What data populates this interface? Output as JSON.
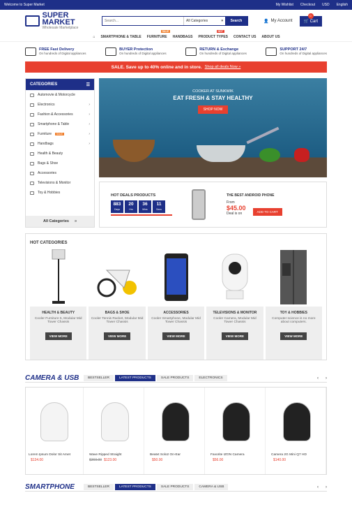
{
  "topbar": {
    "welcome": "Welcome to Super Market",
    "wishlist": "My Wishlist",
    "checkout": "Checkout",
    "currency": "USD",
    "language": "English"
  },
  "logo": {
    "name": "SUPER MARKET",
    "tagline": "Wholesale Marketplace"
  },
  "search": {
    "placeholder": "Search...",
    "category": "All Categories",
    "button": "Search"
  },
  "header": {
    "account": "My Account",
    "cart": "Cart",
    "cart_count": "0"
  },
  "nav": {
    "items": [
      "SMARTPHONE & TABLE",
      "FURNITURE",
      "HANDBAGS",
      "PRODUCT TYPES",
      "CONTACT US",
      "ABOUT US"
    ],
    "tag_sale": "SALE",
    "tag_hot": "HOT"
  },
  "features": [
    {
      "title": "FREE Fast Delivery",
      "sub": "On hundreds of Digital appliances"
    },
    {
      "title": "BUYER Protection",
      "sub": "On hundreds of Digital appliances"
    },
    {
      "title": "RETURN & Exchange",
      "sub": "On hundreds of Digital appliances"
    },
    {
      "title": "SUPPORT 24/7",
      "sub": "On hundreds of Digital appliances"
    }
  ],
  "sale": {
    "text": "SALE. Save up to 40% online and in store.",
    "link": "Shop all deals Now »"
  },
  "categories": {
    "title": "CATEGORIES",
    "items": [
      "Automovie & Motorcycle",
      "Electronics",
      "Fashion & Accessories",
      "Smartphone & Table",
      "Furniture",
      "Handbags",
      "Health & Beauty",
      "Bags & Shoe",
      "Accessories",
      "Televisions & Monitor",
      "Toy & Hobbies"
    ],
    "sale_tag": "SALE",
    "all": "All Categories"
  },
  "banner": {
    "line1": "COOKER AT SUNKWIK",
    "line2": "EAT FRESH & STAY HEALTHY",
    "button": "SHOP NOW"
  },
  "deals": {
    "title": "HOT DEALS PRODUCTS",
    "countdown": [
      {
        "v": "883",
        "l": "Days"
      },
      {
        "v": "20",
        "l": "Hrs"
      },
      {
        "v": "36",
        "l": "Mins"
      },
      {
        "v": "11",
        "l": "Secs"
      }
    ],
    "product": "THE BEST ANDROID PHONE",
    "from": "From",
    "price": "$45.00",
    "deal": "Deal is on",
    "add": "ADD TO CART"
  },
  "hot_categories": {
    "title": "HOT CATEGORIES",
    "items": [
      {
        "name": "HEALTH & BEAUTY",
        "desc": "Cooler Furniture 5, Modular Mid Tower Chassis"
      },
      {
        "name": "BAGS & SHOE",
        "desc": "Cooler Tennis Racket, Modular Mid Tower Chassis"
      },
      {
        "name": "ACCESSORIES",
        "desc": "Cooler Smartphone, Modular Mid Tower Chassis"
      },
      {
        "name": "TELEVISIONS & MONITOR",
        "desc": "Cooler Camera, Modular Mid Tower Chassis"
      },
      {
        "name": "TOY & HOBBIES",
        "desc": "Computer science is no more about computers."
      }
    ],
    "button": "VIEW MORE"
  },
  "camera": {
    "title": "CAMERA & USB",
    "tabs": [
      "BESTSELLER",
      "LATEST PRODUCTS",
      "SALE PRODUCTS",
      "ELECTRONICS"
    ],
    "products": [
      {
        "name": "Lorem Ipsum Dolor Sit Amet",
        "old": "",
        "price": "$134.00"
      },
      {
        "name": "Wave Ripped Straight",
        "old": "$369.00",
        "price": "$123.00"
      },
      {
        "name": "Beatvt Solo2 On-Ear",
        "old": "",
        "price": "$50.00"
      },
      {
        "name": "Favorite IZON Camera",
        "old": "",
        "price": "$56.00"
      },
      {
        "name": "Camera 2G Mini Q7 HD",
        "old": "",
        "price": "$140.00"
      }
    ]
  },
  "smartphone": {
    "title": "SMARTPHONE",
    "tabs": [
      "BESTSELLER",
      "LATEST PRODUCTS",
      "SALE PRODUCTS",
      "CAMERA & USB"
    ]
  },
  "colors": {
    "brand": "#1e2f88",
    "accent": "#e8402f",
    "tag": "#f07e2a"
  }
}
